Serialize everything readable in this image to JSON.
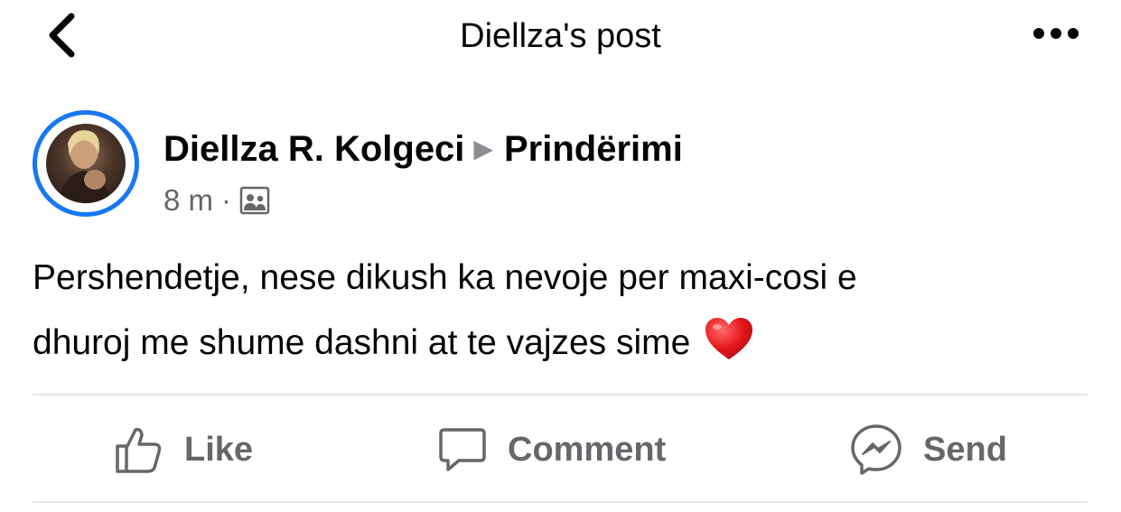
{
  "header": {
    "title": "Diellza's post",
    "back_icon": "chevron-left-icon",
    "more_icon": "more-horizontal-icon"
  },
  "post": {
    "author": "Diellza R. Kolgeci",
    "group": "Prindërimi",
    "time": "8 m",
    "separator": "·",
    "audience_icon": "group-icon",
    "text_lines": [
      "Pershendetje, nese dikush ka nevoje per maxi-cosi e",
      "dhuroj me shume dashni at te vajzes sime"
    ],
    "emoji": "heart-icon",
    "avatar_ring_color": "#1877f2"
  },
  "actions": {
    "like_label": "Like",
    "comment_label": "Comment",
    "send_label": "Send"
  },
  "colors": {
    "text_primary": "#050505",
    "text_secondary": "#65676b",
    "accent": "#1877f2",
    "divider": "#e4e6eb"
  }
}
